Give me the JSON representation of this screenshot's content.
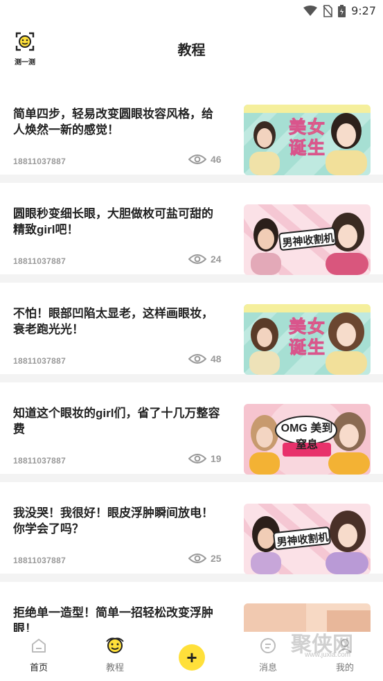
{
  "status_bar": {
    "time": "9:27"
  },
  "header": {
    "logo_label": "测一测",
    "title": "教程"
  },
  "feed": {
    "items": [
      {
        "title": "简单四步，轻易改变圆眼妆容风格，给人焕然一新的感觉！",
        "author": "18811037887",
        "views": "46",
        "thumb_text": "美女诞生",
        "thumb_theme": "teal"
      },
      {
        "title": "圆眼秒变细长眼，大胆做枚可盐可甜的精致girl吧！",
        "author": "18811037887",
        "views": "24",
        "thumb_text": "男神收割机",
        "thumb_theme": "pink"
      },
      {
        "title": "不怕！眼部凹陷太显老，这样画眼妆，衰老跑光光！",
        "author": "18811037887",
        "views": "48",
        "thumb_text": "美女诞生",
        "thumb_theme": "teal"
      },
      {
        "title": "知道这个眼妆的girl们，省了十几万整容费",
        "author": "18811037887",
        "views": "19",
        "thumb_text": "OMG 美到窒息",
        "thumb_theme": "rose"
      },
      {
        "title": "我没哭！我很好！眼皮浮肿瞬间放电！你学会了吗？",
        "author": "18811037887",
        "views": "25",
        "thumb_text": "男神收割机",
        "thumb_theme": "pink"
      },
      {
        "title": "拒绝单一造型！简单一招轻松改变浮肿眼！",
        "author": "",
        "views": "",
        "thumb_text": "",
        "thumb_theme": "plain"
      }
    ]
  },
  "tabbar": {
    "tabs": [
      {
        "label": "首页",
        "icon": "home-icon"
      },
      {
        "label": "教程",
        "icon": "tutorial-face-icon"
      },
      {
        "label": "+",
        "icon": "add-icon"
      },
      {
        "label": "消息",
        "icon": "message-icon"
      },
      {
        "label": "我的",
        "icon": "profile-icon"
      }
    ]
  },
  "watermark": {
    "text": "聚侠网",
    "url": "www.juxia.com"
  },
  "colors": {
    "accent": "#FFE03A",
    "teal": "#4ec6b5",
    "pink": "#f4b8c8"
  }
}
